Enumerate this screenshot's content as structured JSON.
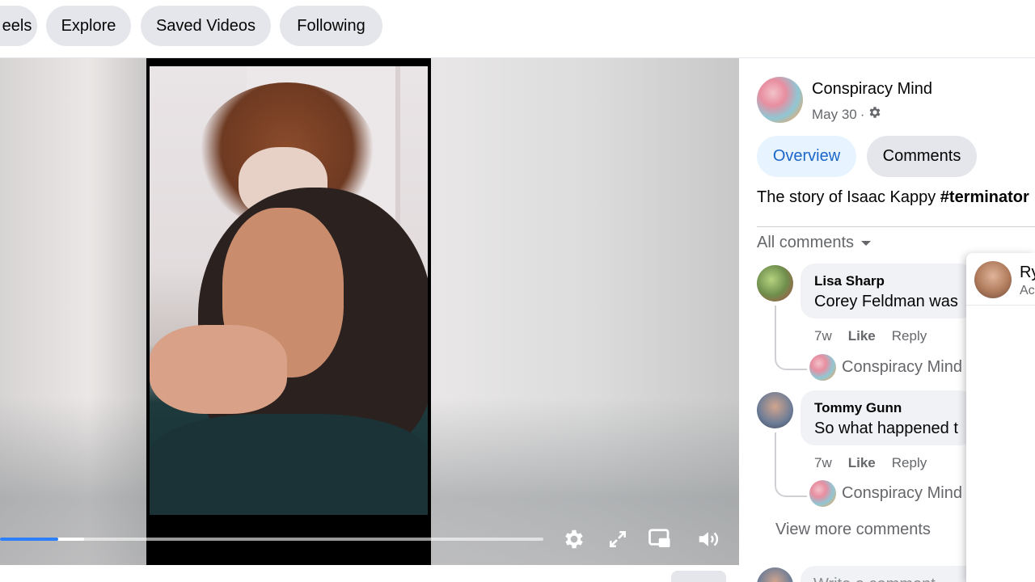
{
  "nav": {
    "tabs": [
      {
        "label": "eels"
      },
      {
        "label": "Explore"
      },
      {
        "label": "Saved Videos"
      },
      {
        "label": "Following"
      }
    ]
  },
  "player": {
    "progress_fraction": 0.107,
    "buffered_fraction": 0.155,
    "controls": [
      "settings-icon",
      "fullscreen-icon",
      "picture-in-picture-icon",
      "volume-icon"
    ],
    "accent_color": "#2d7ff9"
  },
  "post": {
    "author": "Conspiracy Mind",
    "date": "May 30",
    "separator": "·",
    "tabs": {
      "overview": "Overview",
      "comments": "Comments"
    },
    "caption_text": "The story of Isaac Kappy ",
    "caption_hashtag": "#terminator"
  },
  "comments": {
    "filter_label": "All comments",
    "items": [
      {
        "name": "Lisa Sharp",
        "text": "Corey Feldman was",
        "time": "7w",
        "like": "Like",
        "reply": "Reply",
        "reply_author": "Conspiracy Mind"
      },
      {
        "name": "Tommy Gunn",
        "text": "So what happened t",
        "time": "7w",
        "like": "Like",
        "reply": "Reply",
        "reply_author": "Conspiracy Mind"
      }
    ],
    "view_more": "View more comments",
    "write_placeholder": "Write a comment..."
  },
  "hover_card": {
    "name": "Ry",
    "sub": "Ac"
  }
}
